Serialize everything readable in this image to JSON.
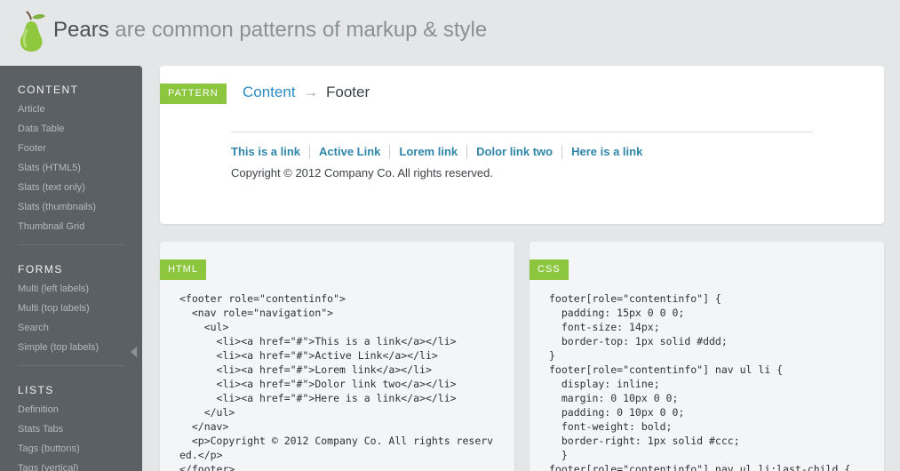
{
  "header": {
    "brand_name": "Pears",
    "tagline": "are common patterns of markup & style"
  },
  "sidebar": {
    "groups": [
      {
        "heading": "Content",
        "items": [
          "Article",
          "Data Table",
          "Footer",
          "Slats (HTML5)",
          "Slats (text only)",
          "Slats (thumbnails)",
          "Thumbnail Grid"
        ]
      },
      {
        "heading": "Forms",
        "items": [
          "Multi (left labels)",
          "Multi (top labels)",
          "Search",
          "Simple (top labels)"
        ]
      },
      {
        "heading": "Lists",
        "items": [
          "Definition",
          "Stats Tabs",
          "Tags (buttons)",
          "Tags (vertical)"
        ]
      }
    ]
  },
  "pattern": {
    "tab_label": "Pattern",
    "breadcrumb_parent": "Content",
    "breadcrumb_arrow": "→",
    "breadcrumb_current": "Footer",
    "links": [
      "This is a link",
      "Active Link",
      "Lorem link",
      "Dolor link two",
      "Here is a link"
    ],
    "copyright": "Copyright © 2012 Company Co. All rights reserved."
  },
  "html_panel": {
    "tab_label": "HTML",
    "code": "<footer role=\"contentinfo\">\n  <nav role=\"navigation\">\n    <ul>\n      <li><a href=\"#\">This is a link</a></li>\n      <li><a href=\"#\">Active Link</a></li>\n      <li><a href=\"#\">Lorem link</a></li>\n      <li><a href=\"#\">Dolor link two</a></li>\n      <li><a href=\"#\">Here is a link</a></li>\n    </ul>\n  </nav>\n  <p>Copyright © 2012 Company Co. All rights reserv\ned.</p>\n</footer>"
  },
  "css_panel": {
    "tab_label": "CSS",
    "code": "footer[role=\"contentinfo\"] {\n  padding: 15px 0 0 0;\n  font-size: 14px;\n  border-top: 1px solid #ddd;\n}\nfooter[role=\"contentinfo\"] nav ul li {\n  display: inline;\n  margin: 0 10px 0 0;\n  padding: 0 10px 0 0;\n  font-weight: bold;\n  border-right: 1px solid #ccc;\n  }\nfooter[role=\"contentinfo\"] nav ul li:last-child {"
  },
  "colors": {
    "accent_green": "#8cc63f",
    "link_blue": "#2b8cc4",
    "sidebar_bg": "#5b6064"
  },
  "icons": {
    "logo": "pear-logo-icon",
    "collapse": "collapse-arrow-icon",
    "breadcrumb_arrow": "arrow-right-icon"
  }
}
